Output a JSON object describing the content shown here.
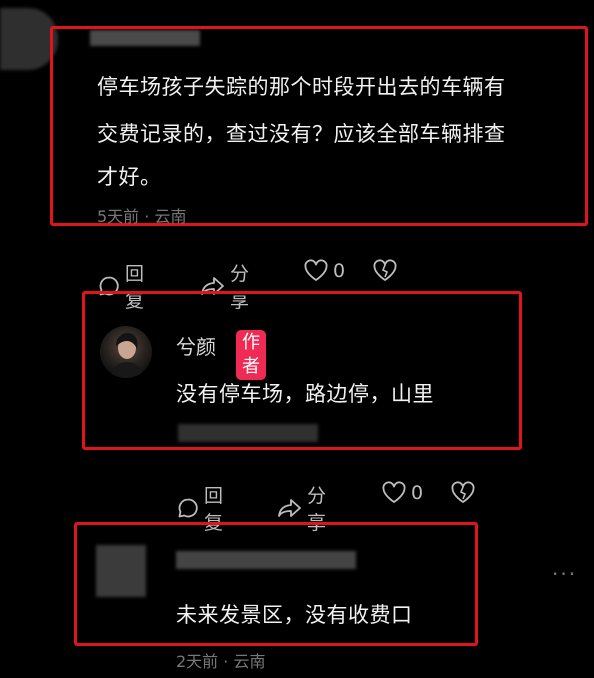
{
  "comment1": {
    "lines": [
      "停车场孩子失踪的那个时段开出去的车辆有",
      "交费记录的，查过没有？应该全部车辆排查",
      "才好。"
    ],
    "meta": "5天前 · 云南",
    "actions": {
      "reply": "回复",
      "share": "分享",
      "like_count": "0"
    }
  },
  "reply1": {
    "username": "兮颜",
    "badge": "作者",
    "text": "没有停车场，路边停，山里",
    "actions": {
      "reply": "回复",
      "share": "分享",
      "like_count": "0"
    }
  },
  "comment2": {
    "text": "未来发景区，没有收费口",
    "meta": "2天前 · 云南",
    "more": "···"
  },
  "colors": {
    "highlight_box": "#e0151b",
    "author_badge": "#ef2b55",
    "background": "#000000"
  }
}
